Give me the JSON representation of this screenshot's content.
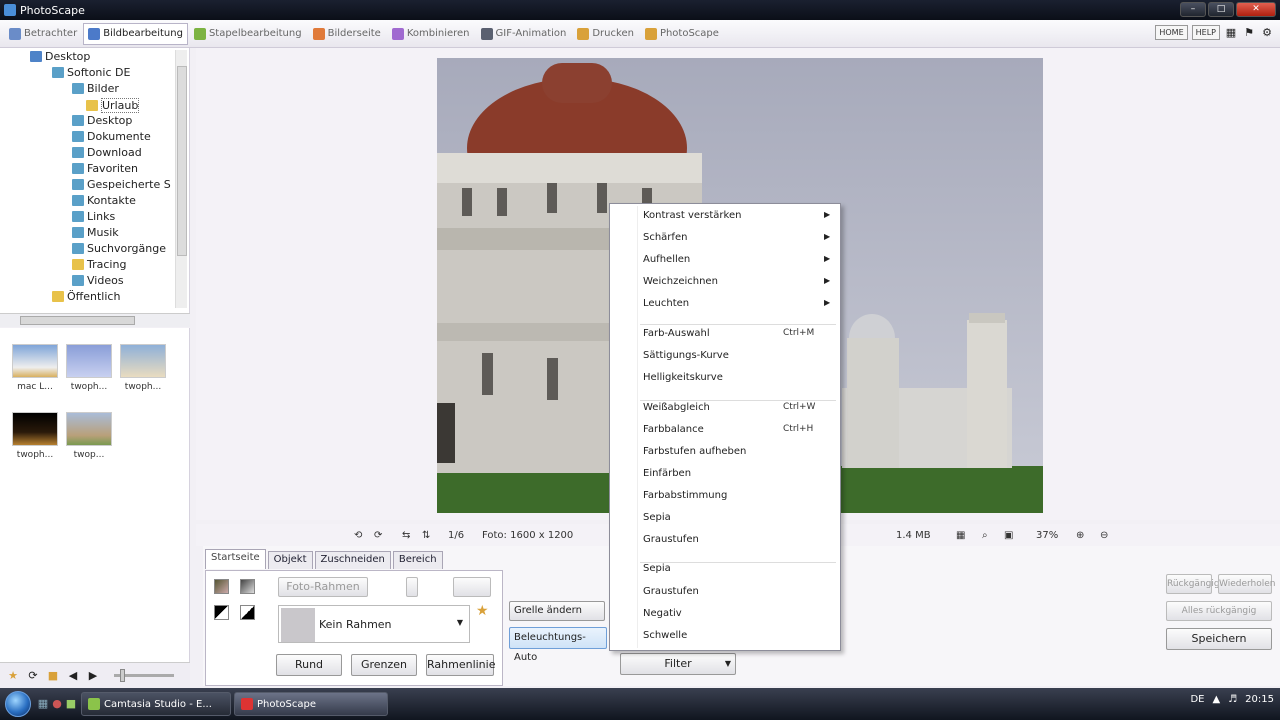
{
  "window": {
    "title": "PhotoScape"
  },
  "toolbar": {
    "tabs": [
      {
        "label": "Betrachter",
        "color": "#6a8cc8"
      },
      {
        "label": "Bildbearbeitung",
        "color": "#4c7ac9"
      },
      {
        "label": "Stapelbearbeitung",
        "color": "#7cb342"
      },
      {
        "label": "Bilderseite",
        "color": "#e07a3a"
      },
      {
        "label": "Kombinieren",
        "color": "#a06ad0"
      },
      {
        "label": "GIF-Animation",
        "color": "#5a6070"
      },
      {
        "label": "Drucken",
        "color": "#d9a13a"
      },
      {
        "label": "PhotoScape",
        "color": "#d9a13a"
      }
    ],
    "right_buttons": [
      "HOME",
      "HELP"
    ]
  },
  "tree": {
    "items": [
      {
        "label": "Desktop"
      },
      {
        "label": "Softonic DE"
      },
      {
        "label": "Bilder"
      },
      {
        "label": "Urlaub"
      },
      {
        "label": "Desktop"
      },
      {
        "label": "Dokumente"
      },
      {
        "label": "Download"
      },
      {
        "label": "Favoriten"
      },
      {
        "label": "Gespeicherte S"
      },
      {
        "label": "Kontakte"
      },
      {
        "label": "Links"
      },
      {
        "label": "Musik"
      },
      {
        "label": "Suchvorgänge"
      },
      {
        "label": "Tracing"
      },
      {
        "label": "Videos"
      },
      {
        "label": "Öffentlich"
      }
    ]
  },
  "thumbnails": [
    {
      "caption": "mac  L..."
    },
    {
      "caption": "twoph..."
    },
    {
      "caption": "twoph..."
    },
    {
      "caption": "twoph..."
    },
    {
      "caption": "twop..."
    }
  ],
  "status": {
    "size": "Foto: 1600 x 1200",
    "filesize": "1.4 MB",
    "zoom": "37%",
    "count": "1/6"
  },
  "tabs": [
    "Startseite",
    "Objekt",
    "Zuschneiden",
    "Bereich"
  ],
  "panel": {
    "frame_btn": "Foto-Rahmen",
    "frame_value": "Kein Rahmen",
    "round_btn": "Rund",
    "margin_btn": "Grenzen",
    "frameline_btn": "Rahmenlinie",
    "glow_dropdown": "Grelle ändern",
    "auto_dropdown": "Beleuchtungs-Auto",
    "filter_dropdown": "Filter"
  },
  "right_panel": {
    "undo": "Rückgängig",
    "redo": "Wiederholen",
    "undo_all": "Alles rückgängig",
    "save": "Speichern"
  },
  "context_menu": {
    "items": [
      {
        "label": "Kontrast verstärken",
        "shortcut": "",
        "arrow": true
      },
      {
        "label": "Schärfen",
        "shortcut": "",
        "arrow": true
      },
      {
        "label": "Aufhellen",
        "shortcut": "",
        "arrow": true
      },
      {
        "label": "Weichzeichnen",
        "shortcut": "",
        "arrow": true
      },
      {
        "label": "Leuchten",
        "shortcut": "",
        "arrow": true
      },
      {
        "sep": true
      },
      {
        "label": "Farb-Auswahl",
        "shortcut": "Ctrl+M",
        "arrow": false
      },
      {
        "label": "Sättigungs-Kurve",
        "shortcut": "",
        "arrow": false
      },
      {
        "label": "Helligkeitskurve",
        "shortcut": "",
        "arrow": false
      },
      {
        "sep": true
      },
      {
        "label": "Weißabgleich",
        "shortcut": "Ctrl+W",
        "arrow": false
      },
      {
        "label": "Farbbalance",
        "shortcut": "Ctrl+H",
        "arrow": false
      },
      {
        "label": "Farbstufen aufheben",
        "shortcut": "",
        "arrow": false
      },
      {
        "label": "Einfärben",
        "shortcut": "",
        "arrow": false
      },
      {
        "label": "Farbabstimmung",
        "shortcut": "",
        "arrow": false
      },
      {
        "label": "Sepia",
        "shortcut": "",
        "arrow": false
      },
      {
        "label": "Graustufen",
        "shortcut": "",
        "arrow": false
      },
      {
        "sep": true
      },
      {
        "label": "Sepia",
        "shortcut": "",
        "arrow": false
      },
      {
        "label": "Graustufen",
        "shortcut": "",
        "arrow": false
      },
      {
        "label": "Negativ",
        "shortcut": "",
        "arrow": false
      },
      {
        "label": "Schwelle",
        "shortcut": "",
        "arrow": false
      }
    ]
  },
  "taskbar": {
    "buttons": [
      {
        "label": "Camtasia Studio - E..."
      },
      {
        "label": "PhotoScape"
      }
    ],
    "tray_lang": "DE",
    "clock": "20:15"
  }
}
